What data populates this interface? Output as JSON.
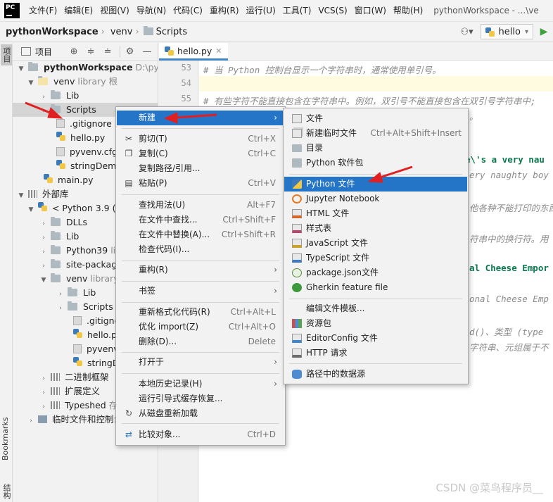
{
  "menubar": {
    "logo": "PC",
    "items": [
      "文件(F)",
      "编辑(E)",
      "视图(V)",
      "导航(N)",
      "代码(C)",
      "重构(R)",
      "运行(U)",
      "工具(T)",
      "VCS(S)",
      "窗口(W)",
      "帮助(H)"
    ],
    "window_title": "pythonWorkspace - ...\\ve"
  },
  "navbar": {
    "crumbs": [
      "pythonWorkspace",
      "venv",
      "Scripts"
    ],
    "run_config": "hello"
  },
  "stripe": {
    "project": "项目",
    "bookmarks": "Bookmarks",
    "structure": "结构"
  },
  "project_panel": {
    "title": "项目",
    "tree": [
      {
        "label": "pythonWorkspace",
        "extra": "D:\\pytho",
        "bold": true
      },
      {
        "label": "venv",
        "extra": "library 根"
      },
      {
        "label": "Lib"
      },
      {
        "label": "Scripts"
      },
      {
        "label": ".gitignore"
      },
      {
        "label": "hello.py"
      },
      {
        "label": "pyvenv.cfg"
      },
      {
        "label": "stringDemo"
      },
      {
        "label": "main.py"
      },
      {
        "label": "外部库"
      },
      {
        "label": "< Python 3.9 (p"
      },
      {
        "label": "DLLs"
      },
      {
        "label": "Lib"
      },
      {
        "label": "Python39",
        "extra": "li"
      },
      {
        "label": "site-packag"
      },
      {
        "label": "venv",
        "extra": "library"
      },
      {
        "label": "Lib"
      },
      {
        "label": "Scripts"
      },
      {
        "label": ".gitigno"
      },
      {
        "label": "hello.py"
      },
      {
        "label": "pyvenv.c"
      },
      {
        "label": "stringDe"
      },
      {
        "label": "二进制框架"
      },
      {
        "label": "扩展定义"
      },
      {
        "label": "Typeshed",
        "extra": "存"
      },
      {
        "label": "临时文件和控制台"
      }
    ]
  },
  "editor": {
    "tab": "hello.py",
    "line_numbers": [
      "53",
      "54",
      "55"
    ],
    "lines": [
      "# 当 Python 控制台显示一个字符串时，通常使用单引号。",
      "",
      "# 有些字符不能直接包含在字符串中。例如，双引号不能直接包含在双引号字符串中;",
      "。",
      "e\\'s a very nau",
      "ery naughty boy",
      "他各种不能打印的东西",
      "符串中的换行符。用",
      "al Cheese Empor",
      "onal Cheese Emp",
      "d()、类型 (type",
      "字符串、元组属于不"
    ]
  },
  "context_menu": {
    "items": [
      {
        "label": "新建",
        "sub": true
      },
      {
        "label": "剪切(T)",
        "shortcut": "Ctrl+X",
        "icon": "cut-icon"
      },
      {
        "label": "复制(C)",
        "shortcut": "Ctrl+C",
        "icon": "copy-icon"
      },
      {
        "label": "复制路径/引用..."
      },
      {
        "label": "粘贴(P)",
        "shortcut": "Ctrl+V",
        "icon": "paste-icon"
      },
      {
        "label": "查找用法(U)",
        "shortcut": "Alt+F7"
      },
      {
        "label": "在文件中查找...",
        "shortcut": "Ctrl+Shift+F"
      },
      {
        "label": "在文件中替换(A)...",
        "shortcut": "Ctrl+Shift+R"
      },
      {
        "label": "检查代码(I)..."
      },
      {
        "label": "重构(R)",
        "sub": true
      },
      {
        "label": "书签",
        "sub": true
      },
      {
        "label": "重新格式化代码(R)",
        "shortcut": "Ctrl+Alt+L"
      },
      {
        "label": "优化 import(Z)",
        "shortcut": "Ctrl+Alt+O"
      },
      {
        "label": "删除(D)...",
        "shortcut": "Delete"
      },
      {
        "label": "打开于",
        "sub": true
      },
      {
        "label": "本地历史记录(H)",
        "sub": true
      },
      {
        "label": "运行引导式缓存恢复..."
      },
      {
        "label": "从磁盘重新加载",
        "icon": "reload-icon"
      },
      {
        "label": "比较对象...",
        "shortcut": "Ctrl+D",
        "icon": "compare-icon"
      }
    ]
  },
  "sub_menu": {
    "items": [
      {
        "label": "文件",
        "icon": "file-icon"
      },
      {
        "label": "新建临时文件",
        "shortcut": "Ctrl+Alt+Shift+Insert",
        "icon": "scratch-file-icon"
      },
      {
        "label": "目录",
        "icon": "folder-icon"
      },
      {
        "label": "Python 软件包",
        "icon": "python-package-icon"
      },
      {
        "label": "Python 文件",
        "icon": "python-file-icon"
      },
      {
        "label": "Jupyter Notebook",
        "icon": "jupyter-icon"
      },
      {
        "label": "HTML 文件",
        "icon": "html-icon"
      },
      {
        "label": "样式表",
        "icon": "css-icon"
      },
      {
        "label": "JavaScript 文件",
        "icon": "javascript-icon"
      },
      {
        "label": "TypeScript 文件",
        "icon": "typescript-icon"
      },
      {
        "label": "package.json文件",
        "icon": "package-json-icon"
      },
      {
        "label": "Gherkin feature file",
        "icon": "gherkin-icon"
      },
      {
        "label": "编辑文件模板...",
        "icon": ""
      },
      {
        "label": "资源包",
        "icon": "resource-bundle-icon"
      },
      {
        "label": "EditorConfig 文件",
        "icon": "editorconfig-icon"
      },
      {
        "label": "HTTP 请求",
        "icon": "http-request-icon"
      },
      {
        "label": "路径中的数据源",
        "icon": "datasource-icon"
      }
    ]
  },
  "watermark": "CSDN @菜鸟程序员__",
  "colors": {
    "menu_highlight": "#2474c8",
    "annotation_arrow": "#e02020"
  }
}
